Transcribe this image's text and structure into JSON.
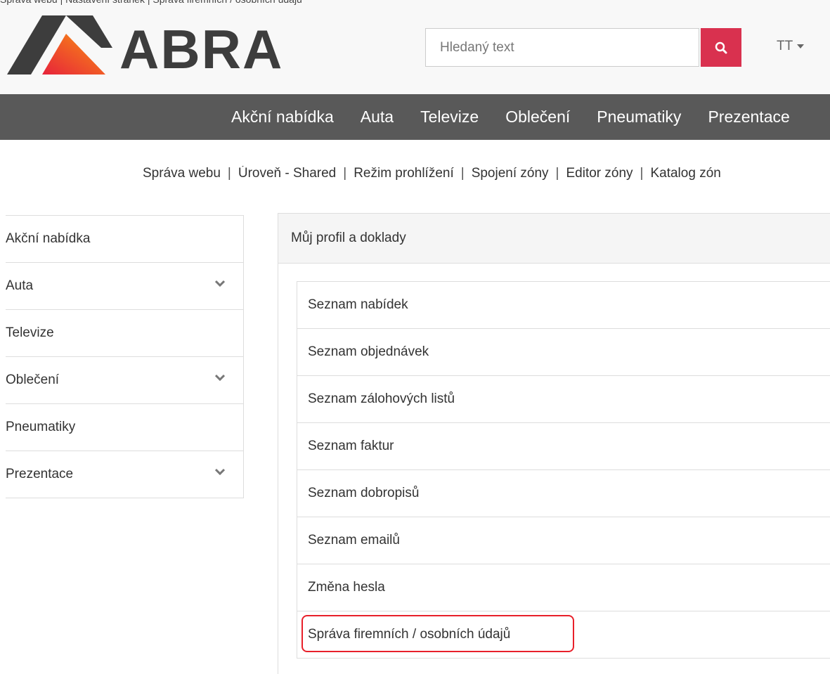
{
  "top_caption": "Správa webu | Nastavení stránek | Správa firemních / osobních údajů",
  "logo": {
    "text": "ABRA"
  },
  "search": {
    "placeholder": "Hledaný text",
    "button_icon": "search-icon"
  },
  "user_menu": {
    "label": "TT"
  },
  "nav": {
    "items": [
      "Akční nabídka",
      "Auta",
      "Televize",
      "Oblečení",
      "Pneumatiky",
      "Prezentace"
    ]
  },
  "admin_links": [
    "Správa webu",
    "Úroveň - Shared",
    "Režim prohlížení",
    "Spojení zóny",
    "Editor zóny",
    "Katalog zón"
  ],
  "sidebar": {
    "items": [
      {
        "label": "Akční nabídka",
        "has_submenu": false
      },
      {
        "label": "Auta",
        "has_submenu": true
      },
      {
        "label": "Televize",
        "has_submenu": false
      },
      {
        "label": "Oblečení",
        "has_submenu": true
      },
      {
        "label": "Pneumatiky",
        "has_submenu": false
      },
      {
        "label": "Prezentace",
        "has_submenu": true
      }
    ]
  },
  "panel": {
    "title": "Můj profil a doklady",
    "items": [
      "Seznam nabídek",
      "Seznam objednávek",
      "Seznam zálohových listů",
      "Seznam faktur",
      "Seznam dobropisů",
      "Seznam emailů",
      "Změna hesla",
      "Správa firemních / osobních údajů"
    ],
    "highlighted": "Správa firemních / osobních údajů"
  },
  "colors": {
    "accent": "#d9314f",
    "navbar_bg": "#595959",
    "highlight_border": "#e8202a",
    "logo_text": "#3d3d3d"
  }
}
